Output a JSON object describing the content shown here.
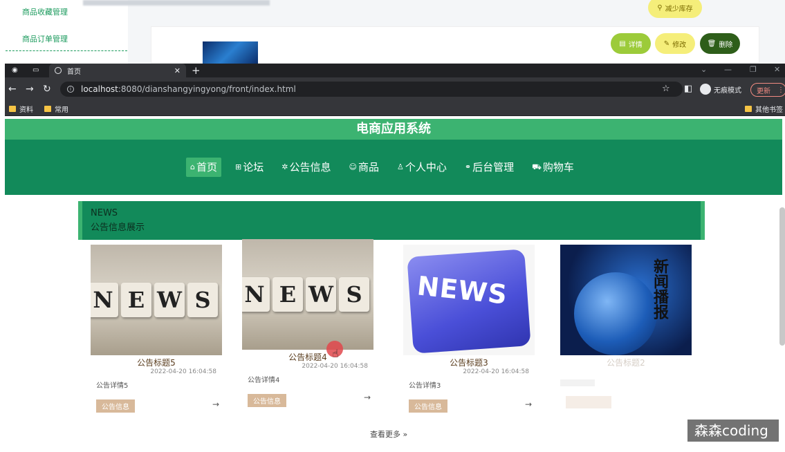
{
  "background_admin": {
    "sidebar_items": [
      "商品收藏管理",
      "商品订单管理"
    ],
    "buttons": {
      "reduce_stock": "减少库存",
      "detail": "详情",
      "edit": "修改",
      "delete": "删除"
    }
  },
  "browser": {
    "tab_title": "首页",
    "url_host": "localhost",
    "url_rest": ":8080/dianshangyingyong/front/index.html",
    "incognito_label": "无痕模式",
    "update_label": "更新",
    "bookmarks": [
      "资料",
      "常用"
    ],
    "other_bookmarks": "其他书签"
  },
  "site": {
    "title": "电商应用系统",
    "nav": [
      {
        "icon": "⌂",
        "label": "首页"
      },
      {
        "icon": "⊞",
        "label": "论坛"
      },
      {
        "icon": "✲",
        "label": "公告信息"
      },
      {
        "icon": "☺",
        "label": "商品"
      },
      {
        "icon": "♙",
        "label": "个人中心"
      },
      {
        "icon": "⚭",
        "label": "后台管理"
      },
      {
        "icon": "⛟",
        "label": "购物车"
      }
    ],
    "news_header": {
      "en": "NEWS",
      "zh": "公告信息展示"
    },
    "cards": [
      {
        "title": "公告标题5",
        "date": "2022-04-20 16:04:58",
        "desc": "公告详情5",
        "tag": "公告信息",
        "arrow": "→",
        "image_text": "NEWS"
      },
      {
        "title": "公告标题4",
        "date": "2022-04-20 16:04:58",
        "desc": "公告详情4",
        "tag": "公告信息",
        "arrow": "→",
        "image_text": "NEWS"
      },
      {
        "title": "公告标题3",
        "date": "2022-04-20 16:04:58",
        "desc": "公告详情3",
        "tag": "公告信息",
        "arrow": "→",
        "image_text": "NEWS"
      },
      {
        "title": "公告标题2",
        "image_text": "新闻播报"
      }
    ],
    "more_label": "查看更多 »"
  },
  "watermark": "森森coding"
}
